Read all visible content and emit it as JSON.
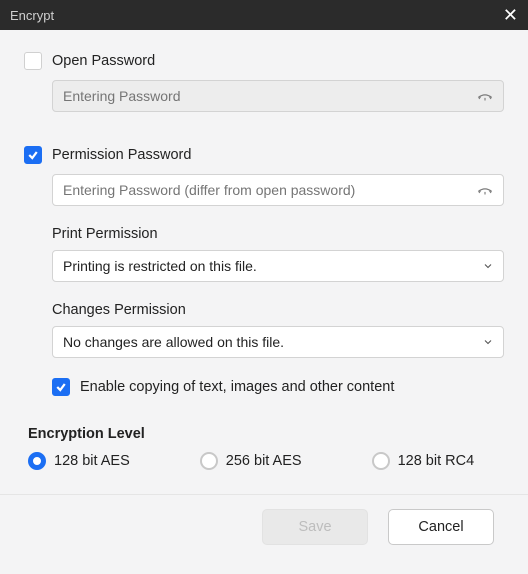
{
  "titlebar": {
    "title": "Encrypt"
  },
  "open_password": {
    "checked": false,
    "label": "Open Password",
    "placeholder": "Entering Password",
    "value": ""
  },
  "permission_password": {
    "checked": true,
    "label": "Permission Password",
    "placeholder": "Entering Password (differ from open password)",
    "value": ""
  },
  "print_permission": {
    "label": "Print Permission",
    "selected": "Printing is restricted on this file."
  },
  "changes_permission": {
    "label": "Changes Permission",
    "selected": "No changes are allowed on this file."
  },
  "enable_copy": {
    "checked": true,
    "label": "Enable copying of text, images and other content"
  },
  "encryption": {
    "heading": "Encryption Level",
    "options": [
      {
        "label": "128 bit AES",
        "checked": true
      },
      {
        "label": "256 bit AES",
        "checked": false
      },
      {
        "label": "128 bit RC4",
        "checked": false
      }
    ]
  },
  "footer": {
    "save": "Save",
    "cancel": "Cancel"
  }
}
